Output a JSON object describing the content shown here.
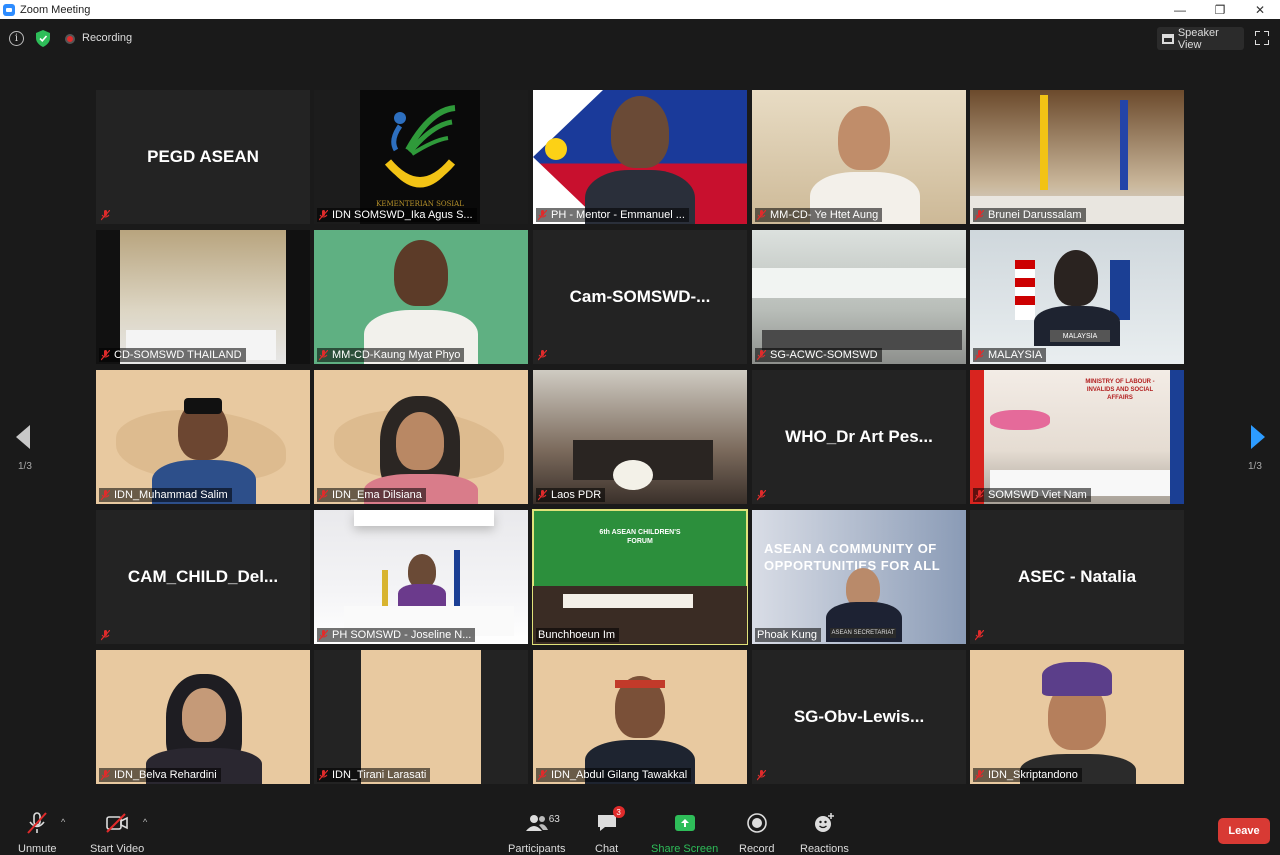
{
  "window": {
    "title": "Zoom Meeting",
    "minimize": "—",
    "restore": "❐",
    "close": "✕"
  },
  "topbar": {
    "recording_label": "Recording",
    "speaker_view_label": "Speaker View"
  },
  "pager": {
    "left_label": "1/3",
    "right_label": "1/3"
  },
  "tiles": [
    {
      "name": "",
      "display": "PEGD ASEAN"
    },
    {
      "name": "IDN SOMSWD_Ika Agus S...",
      "display": "",
      "logo_text": "KEMENTERIAN SOSIAL"
    },
    {
      "name": "PH - Mentor - Emmanuel ...",
      "display": ""
    },
    {
      "name": "MM-CD- Ye Htet Aung",
      "display": ""
    },
    {
      "name": "Brunei Darussalam",
      "display": ""
    },
    {
      "name": "CD-SOMSWD THAILAND",
      "display": ""
    },
    {
      "name": "MM-CD-Kaung Myat Phyo",
      "display": ""
    },
    {
      "name": "",
      "display": "Cam-SOMSWD-..."
    },
    {
      "name": "SG-ACWC-SOMSWD",
      "display": ""
    },
    {
      "name": "MALAYSIA",
      "display": "",
      "sign_text": "MALAYSIA"
    },
    {
      "name": "IDN_Muhammad Salim",
      "display": ""
    },
    {
      "name": "IDN_Ema Dilsiana",
      "display": ""
    },
    {
      "name": "Laos PDR",
      "display": ""
    },
    {
      "name": "",
      "display": "WHO_Dr Art Pes..."
    },
    {
      "name": "SOMSWD Viet Nam",
      "display": "",
      "sign_text": "MINISTRY OF LABOUR - INVALIDS AND SOCIAL AFFAIRS"
    },
    {
      "name": "",
      "display": "CAM_CHILD_Del..."
    },
    {
      "name": "PH SOMSWD - Joseline N...",
      "display": ""
    },
    {
      "name": "Bunchhoeun Im",
      "display": "",
      "banner_text": "6th ASEAN CHILDREN'S FORUM"
    },
    {
      "name": "Phoak Kung",
      "display": "",
      "banner_text": "ASEAN A COMMUNITY OF OPPORTUNITIES FOR ALL",
      "plate_text": "ASEAN SECRETARIAT"
    },
    {
      "name": "",
      "display": "ASEC - Natalia"
    },
    {
      "name": "IDN_Belva Rehardini",
      "display": ""
    },
    {
      "name": "IDN_Tirani Larasati",
      "display": ""
    },
    {
      "name": "IDN_Abdul Gilang Tawakkal",
      "display": ""
    },
    {
      "name": "",
      "display": "SG-Obv-Lewis..."
    },
    {
      "name": "IDN_Skriptandono",
      "display": ""
    }
  ],
  "toolbar": {
    "unmute": "Unmute",
    "start_video": "Start Video",
    "participants": "Participants",
    "participants_count": "63",
    "chat": "Chat",
    "chat_badge": "3",
    "share_screen": "Share Screen",
    "record": "Record",
    "reactions": "Reactions",
    "leave": "Leave"
  },
  "colors": {
    "accent": "#2d9cff",
    "share_green": "#2ebd59",
    "leave_red": "#d83a34",
    "active_speaker": "#e0e27a"
  }
}
